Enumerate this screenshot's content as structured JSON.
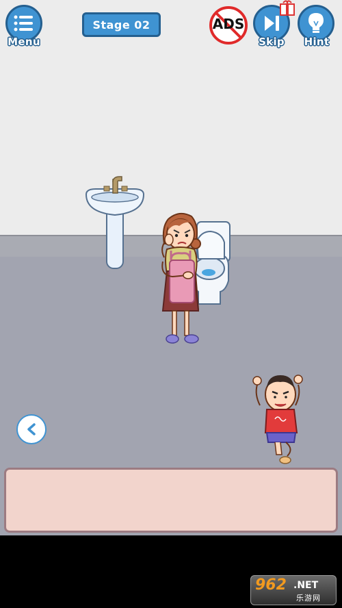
{
  "hud": {
    "menu_label": "Menu",
    "stage_label": "Stage 02",
    "ads_label": "ADS",
    "skip_label": "Skip",
    "hint_label": "Hint"
  },
  "watermark": {
    "brand": "962",
    "suffix": ".NET",
    "subtitle": "乐游网"
  },
  "colors": {
    "button_blue": "#3f93d2",
    "button_border": "#245f8f",
    "wall": "#ececec",
    "floor": "#a2a4b0",
    "panel": "#f2d4cc"
  },
  "icons": [
    "menu-icon",
    "no-ads-icon",
    "skip-icon",
    "hint-bulb-icon",
    "back-arrow-icon"
  ]
}
